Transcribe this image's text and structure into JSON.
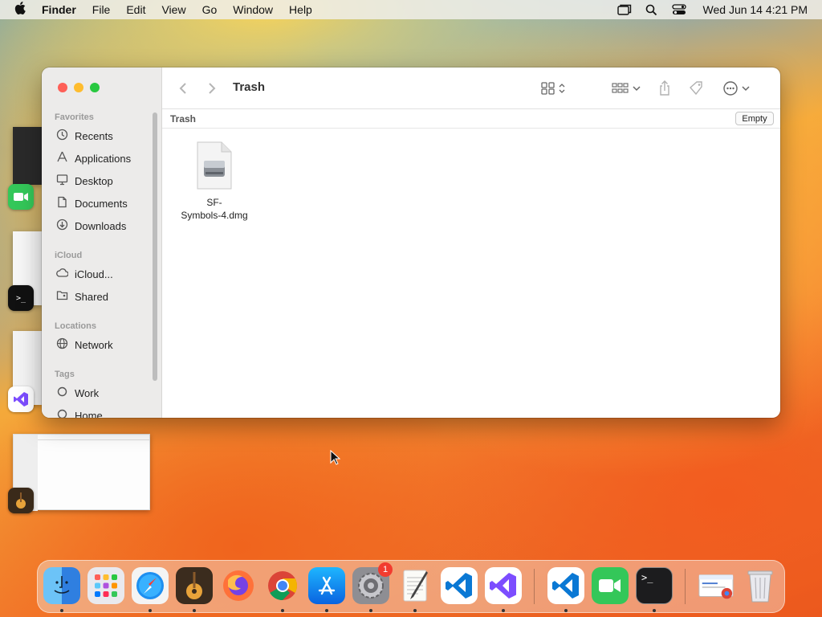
{
  "menubar": {
    "app_name": "Finder",
    "items": [
      "File",
      "Edit",
      "View",
      "Go",
      "Window",
      "Help"
    ],
    "clock": "Wed Jun 14  4:21 PM"
  },
  "window": {
    "title": "Trash",
    "path_label": "Trash",
    "empty_button": "Empty",
    "sidebar": {
      "favorites_header": "Favorites",
      "favorites": [
        {
          "label": "Recents",
          "icon": "clock-icon"
        },
        {
          "label": "Applications",
          "icon": "applications-icon"
        },
        {
          "label": "Desktop",
          "icon": "desktop-icon"
        },
        {
          "label": "Documents",
          "icon": "document-icon"
        },
        {
          "label": "Downloads",
          "icon": "download-icon"
        }
      ],
      "icloud_header": "iCloud",
      "icloud": [
        {
          "label": "iCloud...",
          "icon": "cloud-icon"
        },
        {
          "label": "Shared",
          "icon": "shared-folder-icon"
        }
      ],
      "locations_header": "Locations",
      "locations": [
        {
          "label": "Network",
          "icon": "globe-icon"
        }
      ],
      "tags_header": "Tags",
      "tags": [
        {
          "label": "Work",
          "icon": "tag-circle-icon"
        },
        {
          "label": "Home",
          "icon": "tag-circle-icon"
        }
      ]
    },
    "files": [
      {
        "name_line1": "SF-",
        "name_line2": "Symbols-4.dmg",
        "icon": "disk-image-icon"
      }
    ]
  },
  "dock": {
    "apps": [
      {
        "name": "Finder",
        "icon": "finder-icon",
        "running": true
      },
      {
        "name": "Launchpad",
        "icon": "launchpad-icon",
        "running": false
      },
      {
        "name": "Safari",
        "icon": "safari-icon",
        "running": true
      },
      {
        "name": "GarageBand",
        "icon": "garageband-icon",
        "running": true
      },
      {
        "name": "Firefox",
        "icon": "firefox-icon",
        "running": false
      },
      {
        "name": "Chrome",
        "icon": "chrome-icon",
        "running": true
      },
      {
        "name": "App Store",
        "icon": "app-store-icon",
        "running": true
      },
      {
        "name": "System Settings",
        "icon": "settings-icon",
        "running": true,
        "badge": "1"
      },
      {
        "name": "TextEdit",
        "icon": "textedit-icon",
        "running": true
      },
      {
        "name": "Visual Studio Code",
        "icon": "vscode-icon",
        "running": false
      },
      {
        "name": "Visual Studio",
        "icon": "visual-studio-icon",
        "running": true
      },
      {
        "name": "Visual Studio Code",
        "icon": "vscode-icon",
        "running": true
      },
      {
        "name": "FaceTime",
        "icon": "facetime-icon",
        "running": false
      },
      {
        "name": "Terminal",
        "icon": "terminal-icon",
        "running": true
      },
      {
        "name": "Chrome Downloads",
        "icon": "downloads-stack-icon",
        "running": false
      },
      {
        "name": "Trash",
        "icon": "trash-icon",
        "running": false
      }
    ]
  },
  "colors": {
    "close": "#fe5f57",
    "minimize": "#febc2e",
    "zoom": "#28c840",
    "badge": "#f23b2f"
  }
}
